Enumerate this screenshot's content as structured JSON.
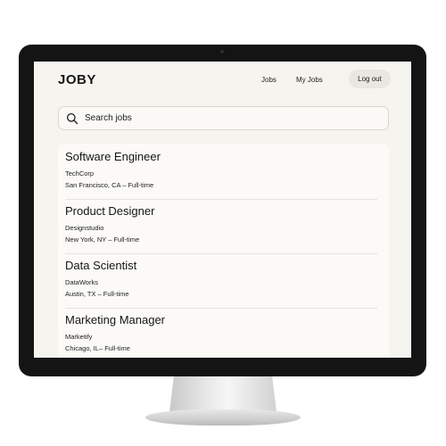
{
  "app": {
    "logo": "JOBY",
    "nav": {
      "jobs": "Jobs",
      "my_jobs": "My Jobs",
      "logout": "Log out"
    }
  },
  "search": {
    "placeholder": "Search jobs",
    "icon": "search-icon"
  },
  "jobs": [
    {
      "title": "Software Engineer",
      "company": "TechCorp",
      "location": "San Francisco, CA – Full-time"
    },
    {
      "title": "Product Designer",
      "company": "Designstudio",
      "location": "New York, NY – Full-time"
    },
    {
      "title": "Data Scientist",
      "company": "DataWorks",
      "location": "Austin, TX – Full-time"
    },
    {
      "title": "Marketing Manager",
      "company": "Marketify",
      "location": "Chicago, IL– Full-time"
    }
  ],
  "colors": {
    "screen_bg": "#f6f4ee",
    "bezel": "#141414",
    "text": "#151515"
  }
}
